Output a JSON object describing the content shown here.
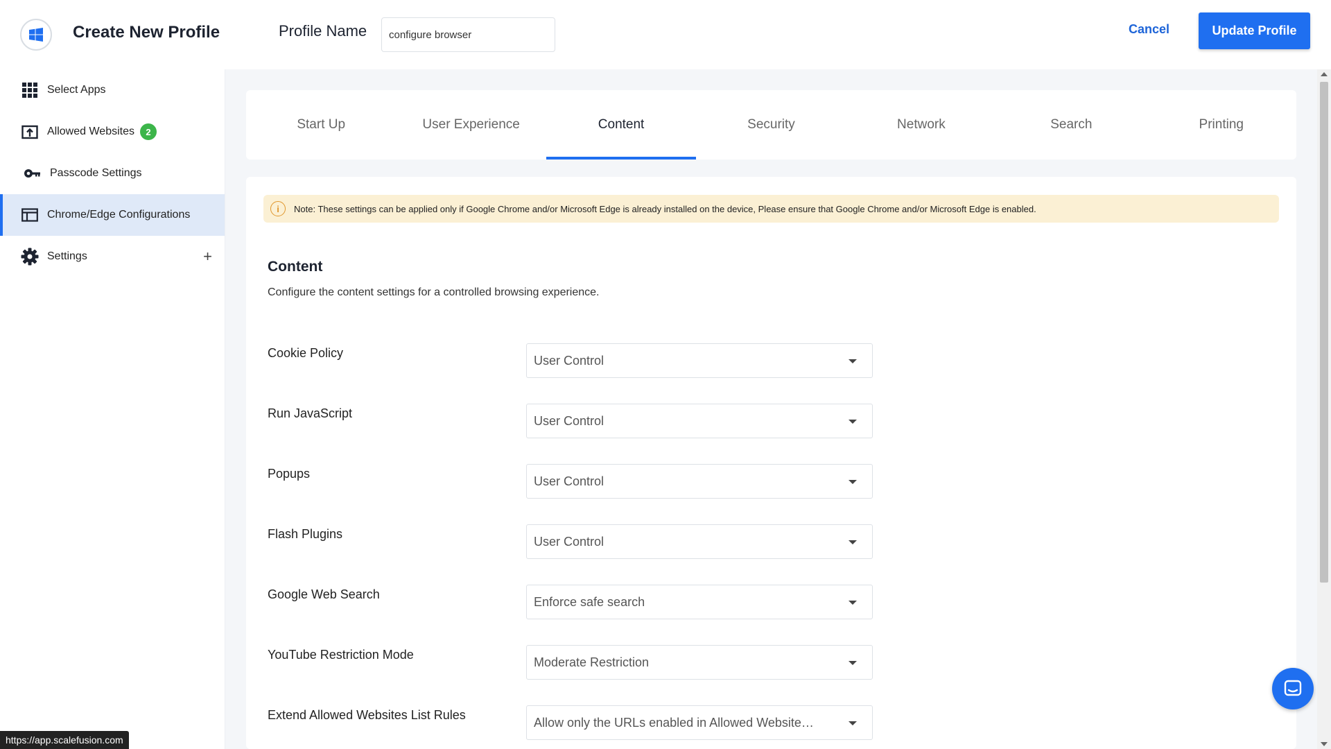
{
  "header": {
    "app_title": "Create New Profile",
    "profile_name_label": "Profile Name",
    "profile_name_value": "configure browser",
    "cancel_label": "Cancel",
    "update_label": "Update Profile"
  },
  "sidebar": {
    "items": [
      {
        "label": "Select Apps",
        "icon": "grid-icon"
      },
      {
        "label": "Allowed Websites",
        "icon": "upload-icon",
        "badge": "2"
      },
      {
        "label": "Passcode Settings",
        "icon": "key-icon"
      },
      {
        "label": "Chrome/Edge Configurations",
        "icon": "browser-window-icon",
        "active": true
      },
      {
        "label": "Settings",
        "icon": "gear-icon",
        "expand": "+"
      }
    ]
  },
  "tabs": [
    {
      "label": "Start Up"
    },
    {
      "label": "User Experience"
    },
    {
      "label": "Content",
      "active": true
    },
    {
      "label": "Security"
    },
    {
      "label": "Network"
    },
    {
      "label": "Search"
    },
    {
      "label": "Printing"
    }
  ],
  "content": {
    "note": "Note: These settings can be applied only if Google Chrome and/or Microsoft Edge is already installed on the device, Please ensure that Google Chrome and/or Microsoft Edge is enabled.",
    "title": "Content",
    "description": "Configure the content settings for a controlled browsing experience.",
    "settings": [
      {
        "label": "Cookie Policy",
        "value": "User Control"
      },
      {
        "label": "Run JavaScript",
        "value": "User Control"
      },
      {
        "label": "Popups",
        "value": "User Control"
      },
      {
        "label": "Flash Plugins",
        "value": "User Control"
      },
      {
        "label": "Google Web Search",
        "value": "Enforce safe search"
      },
      {
        "label": "YouTube Restriction Mode",
        "value": "Moderate Restriction"
      },
      {
        "label": "Extend Allowed Websites List Rules",
        "value": "Allow only the URLs enabled in Allowed Website…"
      }
    ]
  },
  "status_url": "https://app.scalefusion.com",
  "colors": {
    "accent": "#1f6ff0",
    "badge": "#3cb54a",
    "note_bg": "#fbf0d4",
    "active_nav_bg": "#dfe9f8"
  }
}
